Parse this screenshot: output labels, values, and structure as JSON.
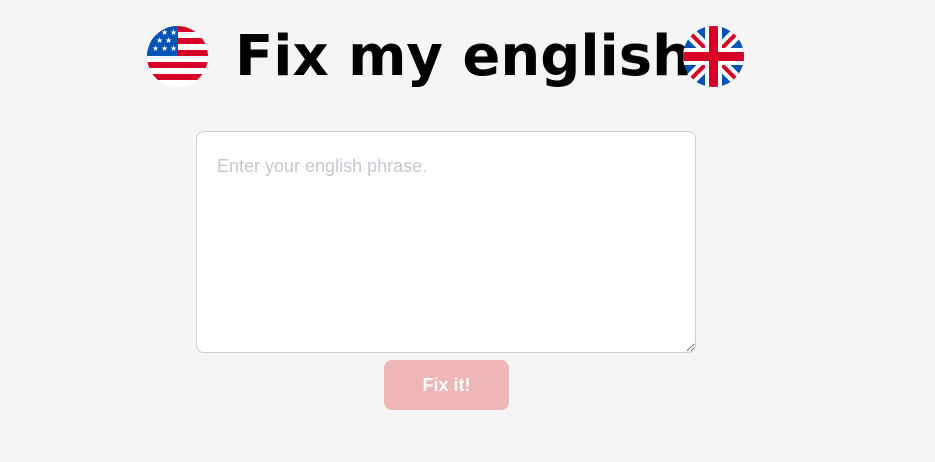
{
  "header": {
    "title": "Fix my english",
    "left_flag_icon": "us-flag-icon",
    "right_flag_icon": "uk-flag-icon"
  },
  "input": {
    "placeholder": "Enter your english phrase.",
    "value": ""
  },
  "actions": {
    "submit_label": "Fix it!",
    "submit_color": "#eeb6b6"
  },
  "colors": {
    "background": "#f5f5f5",
    "flag_red": "#d80027",
    "flag_blue": "#0052b4"
  }
}
